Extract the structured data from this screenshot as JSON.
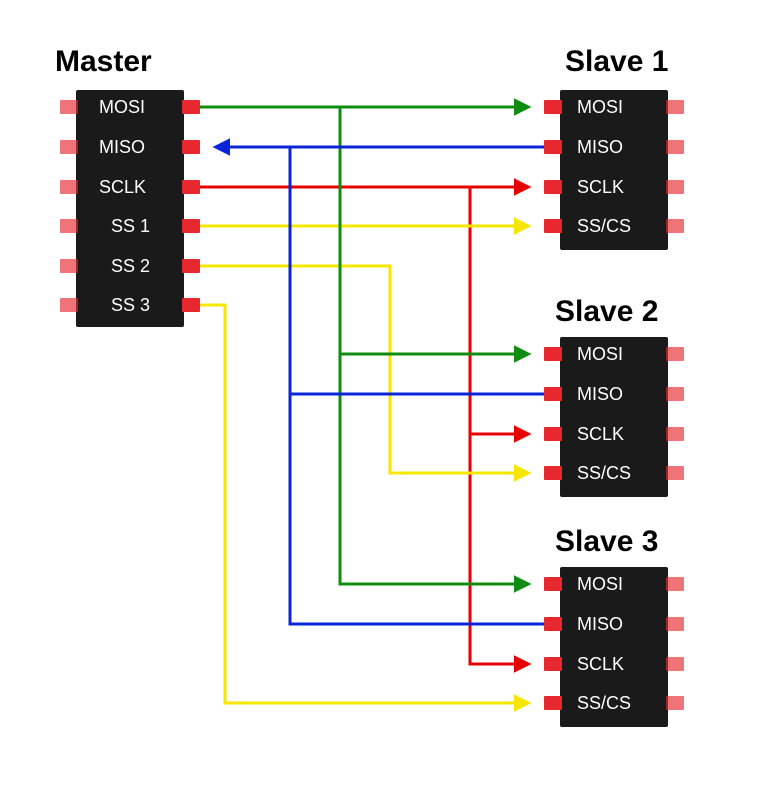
{
  "diagram": {
    "master": {
      "title": "Master",
      "pins": [
        "MOSI",
        "MISO",
        "SCLK",
        "SS 1",
        "SS 2",
        "SS 3"
      ]
    },
    "slaves": [
      {
        "title": "Slave 1",
        "pins": [
          "MOSI",
          "MISO",
          "SCLK",
          "SS/CS"
        ]
      },
      {
        "title": "Slave 2",
        "pins": [
          "MOSI",
          "MISO",
          "SCLK",
          "SS/CS"
        ]
      },
      {
        "title": "Slave 3",
        "pins": [
          "MOSI",
          "MISO",
          "SCLK",
          "SS/CS"
        ]
      }
    ],
    "wire_colors": {
      "mosi": "#108c10",
      "miso": "#0a25d8",
      "sclk": "#e60000",
      "ss": "#f7e600"
    }
  }
}
